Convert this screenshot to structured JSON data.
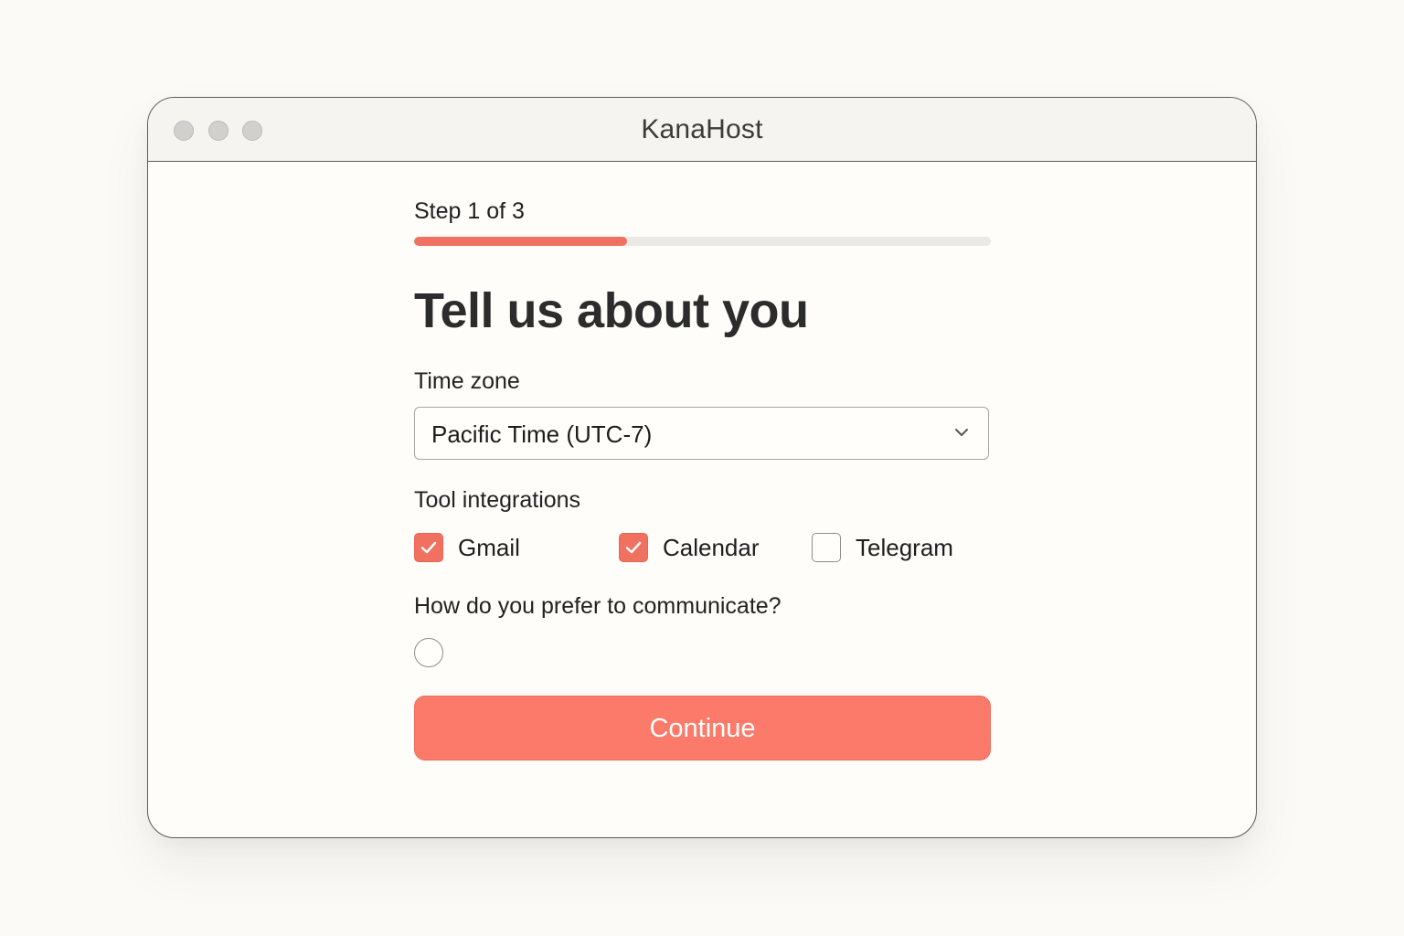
{
  "window": {
    "title": "KanaHost"
  },
  "progress": {
    "label": "Step 1 of 3",
    "current_step": 1,
    "total_steps": 3,
    "fraction": 0.37
  },
  "heading": "Tell us about you",
  "timezone": {
    "label": "Time zone",
    "value": "Pacific Time (UTC-7)",
    "icon": "chevron-down-icon"
  },
  "tools": {
    "label": "Tool integrations",
    "items": [
      {
        "label": "Gmail",
        "checked": true
      },
      {
        "label": "Calendar",
        "checked": true
      },
      {
        "label": "Telegram",
        "checked": false
      }
    ]
  },
  "communication": {
    "label": "How do you prefer to communicate?",
    "selected": false
  },
  "continue_label": "Continue",
  "colors": {
    "accent": "#f17160",
    "button": "#fc7a6a",
    "track": "#ebe9e6",
    "background": "#fbfaf7"
  }
}
